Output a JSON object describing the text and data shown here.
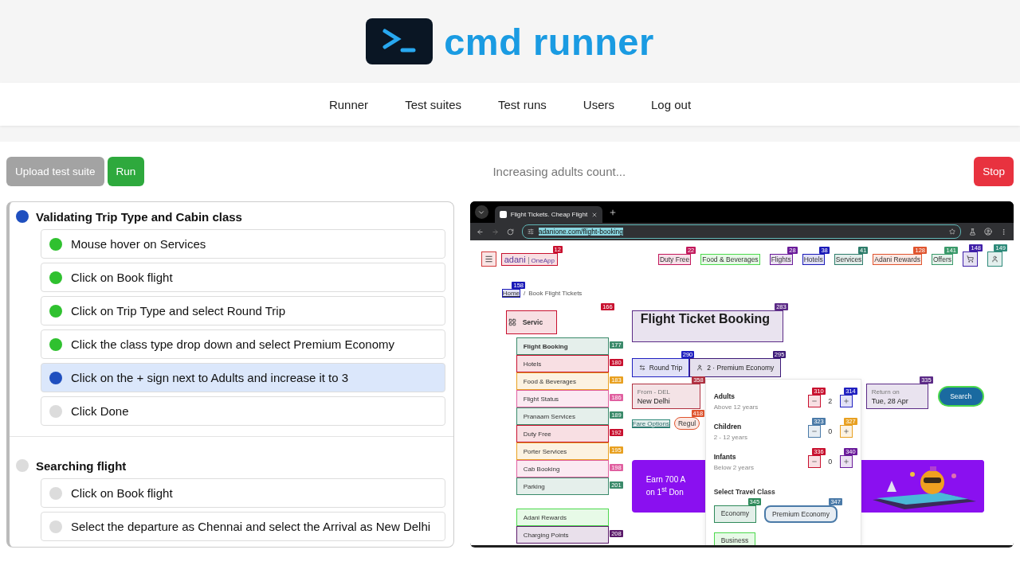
{
  "header": {
    "logo_text": "cmd runner"
  },
  "nav": [
    "Runner",
    "Test suites",
    "Test runs",
    "Users",
    "Log out"
  ],
  "toolbar": {
    "upload_button": "Upload test suite",
    "run_button": "Run",
    "status": "Increasing adults count...",
    "stop_button": "Stop"
  },
  "suites": [
    {
      "title": "Validating Trip Type and Cabin class",
      "color": "#1f4fbf",
      "steps": [
        {
          "text": "Mouse hover on Services",
          "color": "#2fc12f",
          "selected": false
        },
        {
          "text": "Click on Book flight",
          "color": "#2fc12f",
          "selected": false
        },
        {
          "text": "Click on Trip Type and select Round Trip",
          "color": "#2fc12f",
          "selected": false
        },
        {
          "text": "Click the class type drop down and select Premium Economy",
          "color": "#2fc12f",
          "selected": false
        },
        {
          "text": "Click on the + sign next to Adults and increase it to 3",
          "color": "#1f4fbf",
          "selected": true
        },
        {
          "text": "Click Done",
          "color": "#dcdcdc",
          "selected": false
        }
      ]
    },
    {
      "title": "Searching flight",
      "color": "#dcdcdc",
      "steps": [
        {
          "text": "Click on Book flight",
          "color": "#dcdcdc",
          "selected": false
        },
        {
          "text": "Select the departure as Chennai and select the Arrival as New Delhi",
          "color": "#dcdcdc",
          "selected": false
        }
      ]
    }
  ],
  "browser": {
    "tab_title": "Flight Tickets. Cheap Flight",
    "address": "adanione.com/flight-booking",
    "site": {
      "menu_button": {
        "color": "#d33a3a"
      },
      "logo": {
        "text": "adani",
        "sub": "OneApp",
        "badge": "12",
        "color": "#c8102e"
      },
      "nav": [
        {
          "label": "Duty Free",
          "badge": "22",
          "color": "#c2185b"
        },
        {
          "label": "Food & Beverages",
          "color": "#4cd94c"
        },
        {
          "label": "Flights",
          "badge": "28",
          "color": "#6a1b9a"
        },
        {
          "label": "Hotels",
          "badge": "38",
          "color": "#1a1ab8"
        },
        {
          "label": "Services",
          "badge": "41",
          "color": "#2e7d6b"
        },
        {
          "label": "Adani Rewards",
          "badge": "128",
          "color": "#e0542e"
        },
        {
          "label": "Offers",
          "badge": "141",
          "color": "#3a9a6a"
        }
      ],
      "cart": {
        "badge": "148",
        "color": "#3f1fa8"
      },
      "account": {
        "badge": "149",
        "color": "#2e8a7a"
      },
      "breadcrumb": {
        "home": {
          "label": "Home",
          "badge": "158",
          "color": "#1a1ab8"
        },
        "separator": "/",
        "current": "Book Flight Tickets"
      },
      "services": {
        "label": "Servic",
        "badge": "166",
        "color": "#c8102e"
      },
      "services_menu": [
        {
          "label": "Flight Booking",
          "badge": "177",
          "color": "#3a8a6a"
        },
        {
          "label": "Hotels",
          "badge": "180",
          "color": "#c8102e"
        },
        {
          "label": "Food & Beverages",
          "badge": "183",
          "color": "#e8a020"
        },
        {
          "label": "Flight Status",
          "badge": "186",
          "color": "#e060a0"
        },
        {
          "label": "Pranaam Services",
          "badge": "189",
          "color": "#3a8a6a"
        },
        {
          "label": "Duty Free",
          "badge": "192",
          "color": "#c8102e"
        },
        {
          "label": "Porter Services",
          "badge": "195",
          "color": "#e8a020"
        },
        {
          "label": "Cab Booking",
          "badge": "198",
          "color": "#e060a0"
        },
        {
          "label": "Parking",
          "badge": "201",
          "color": "#3a8a6a"
        }
      ],
      "services_menu_extra": [
        {
          "label": "Adani Rewards",
          "color": "#4cd94c"
        },
        {
          "label": "Charging Points",
          "badge": "208",
          "color": "#5b1a6a"
        }
      ],
      "heading": {
        "text": "Flight Ticket Booking",
        "badge": "283",
        "color": "#5b2a86"
      },
      "trip": {
        "label": "Round Trip",
        "badge": "290",
        "color": "#2020c0"
      },
      "passengers": {
        "label": "2 · Premium Economy",
        "badge": "295",
        "color": "#3d1a78"
      },
      "from": {
        "caption": "From - DEL",
        "value": "New Delhi",
        "badge": "358",
        "color": "#b03040"
      },
      "fare_options": {
        "label": "Fare Options",
        "color": "#2e8a7a"
      },
      "fare_chip": {
        "label": "Regul",
        "badge": "418",
        "color": "#e0542e"
      },
      "return": {
        "caption": "Return on",
        "value": "Tue, 28 Apr",
        "badge": "335",
        "color": "#5b2a86"
      },
      "search": {
        "label": "Search",
        "color": "#4cd94c"
      },
      "banner": {
        "lines": [
          "Earn 700 A",
          "on 1$^{st}$ Don"
        ]
      },
      "popup": {
        "rows": [
          {
            "label": "Adults",
            "hint": "Above 12 years",
            "value": "2",
            "minus": {
              "badge": "310",
              "color": "#c8102e"
            },
            "plus": {
              "badge": "314",
              "color": "#2020c0"
            }
          },
          {
            "label": "Children",
            "hint": "2 - 12 years",
            "value": "0",
            "minus": {
              "badge": "323",
              "color": "#4a7aa8"
            },
            "plus": {
              "badge": "327",
              "color": "#e8a020"
            }
          },
          {
            "label": "Infants",
            "hint": "Below 2 years",
            "value": "0",
            "minus": {
              "badge": "336",
              "color": "#c8102e"
            },
            "plus": {
              "badge": "340",
              "color": "#6a1b9a"
            }
          }
        ],
        "class_title": "Select Travel Class",
        "classes": [
          {
            "label": "Economy",
            "badge": "345",
            "color": "#2e8a5a",
            "selected": false
          },
          {
            "label": "Premium Economy",
            "badge": "347",
            "color": "#4a7aa8",
            "selected": true
          },
          {
            "label": "Business",
            "color": "#4cd94c",
            "selected": false
          }
        ]
      }
    }
  }
}
